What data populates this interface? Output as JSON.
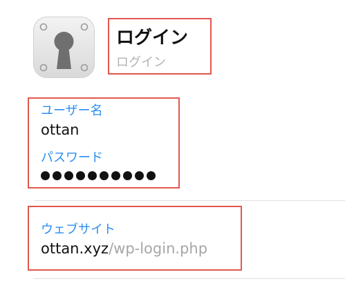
{
  "header": {
    "title": "ログイン",
    "subtitle": "ログイン",
    "app_icon": "keyhole-lock-icon"
  },
  "credentials": {
    "username_label": "ユーザー名",
    "username_value": "ottan",
    "password_label": "パスワード",
    "password_mask": "●●●●●●●●●●"
  },
  "website": {
    "label": "ウェブサイト",
    "domain": "ottan.xyz",
    "path": "/wp-login.php"
  },
  "colors": {
    "highlight": "#e2574c",
    "label_blue": "#2b8ef0",
    "muted_gray": "#a6a6a6"
  }
}
